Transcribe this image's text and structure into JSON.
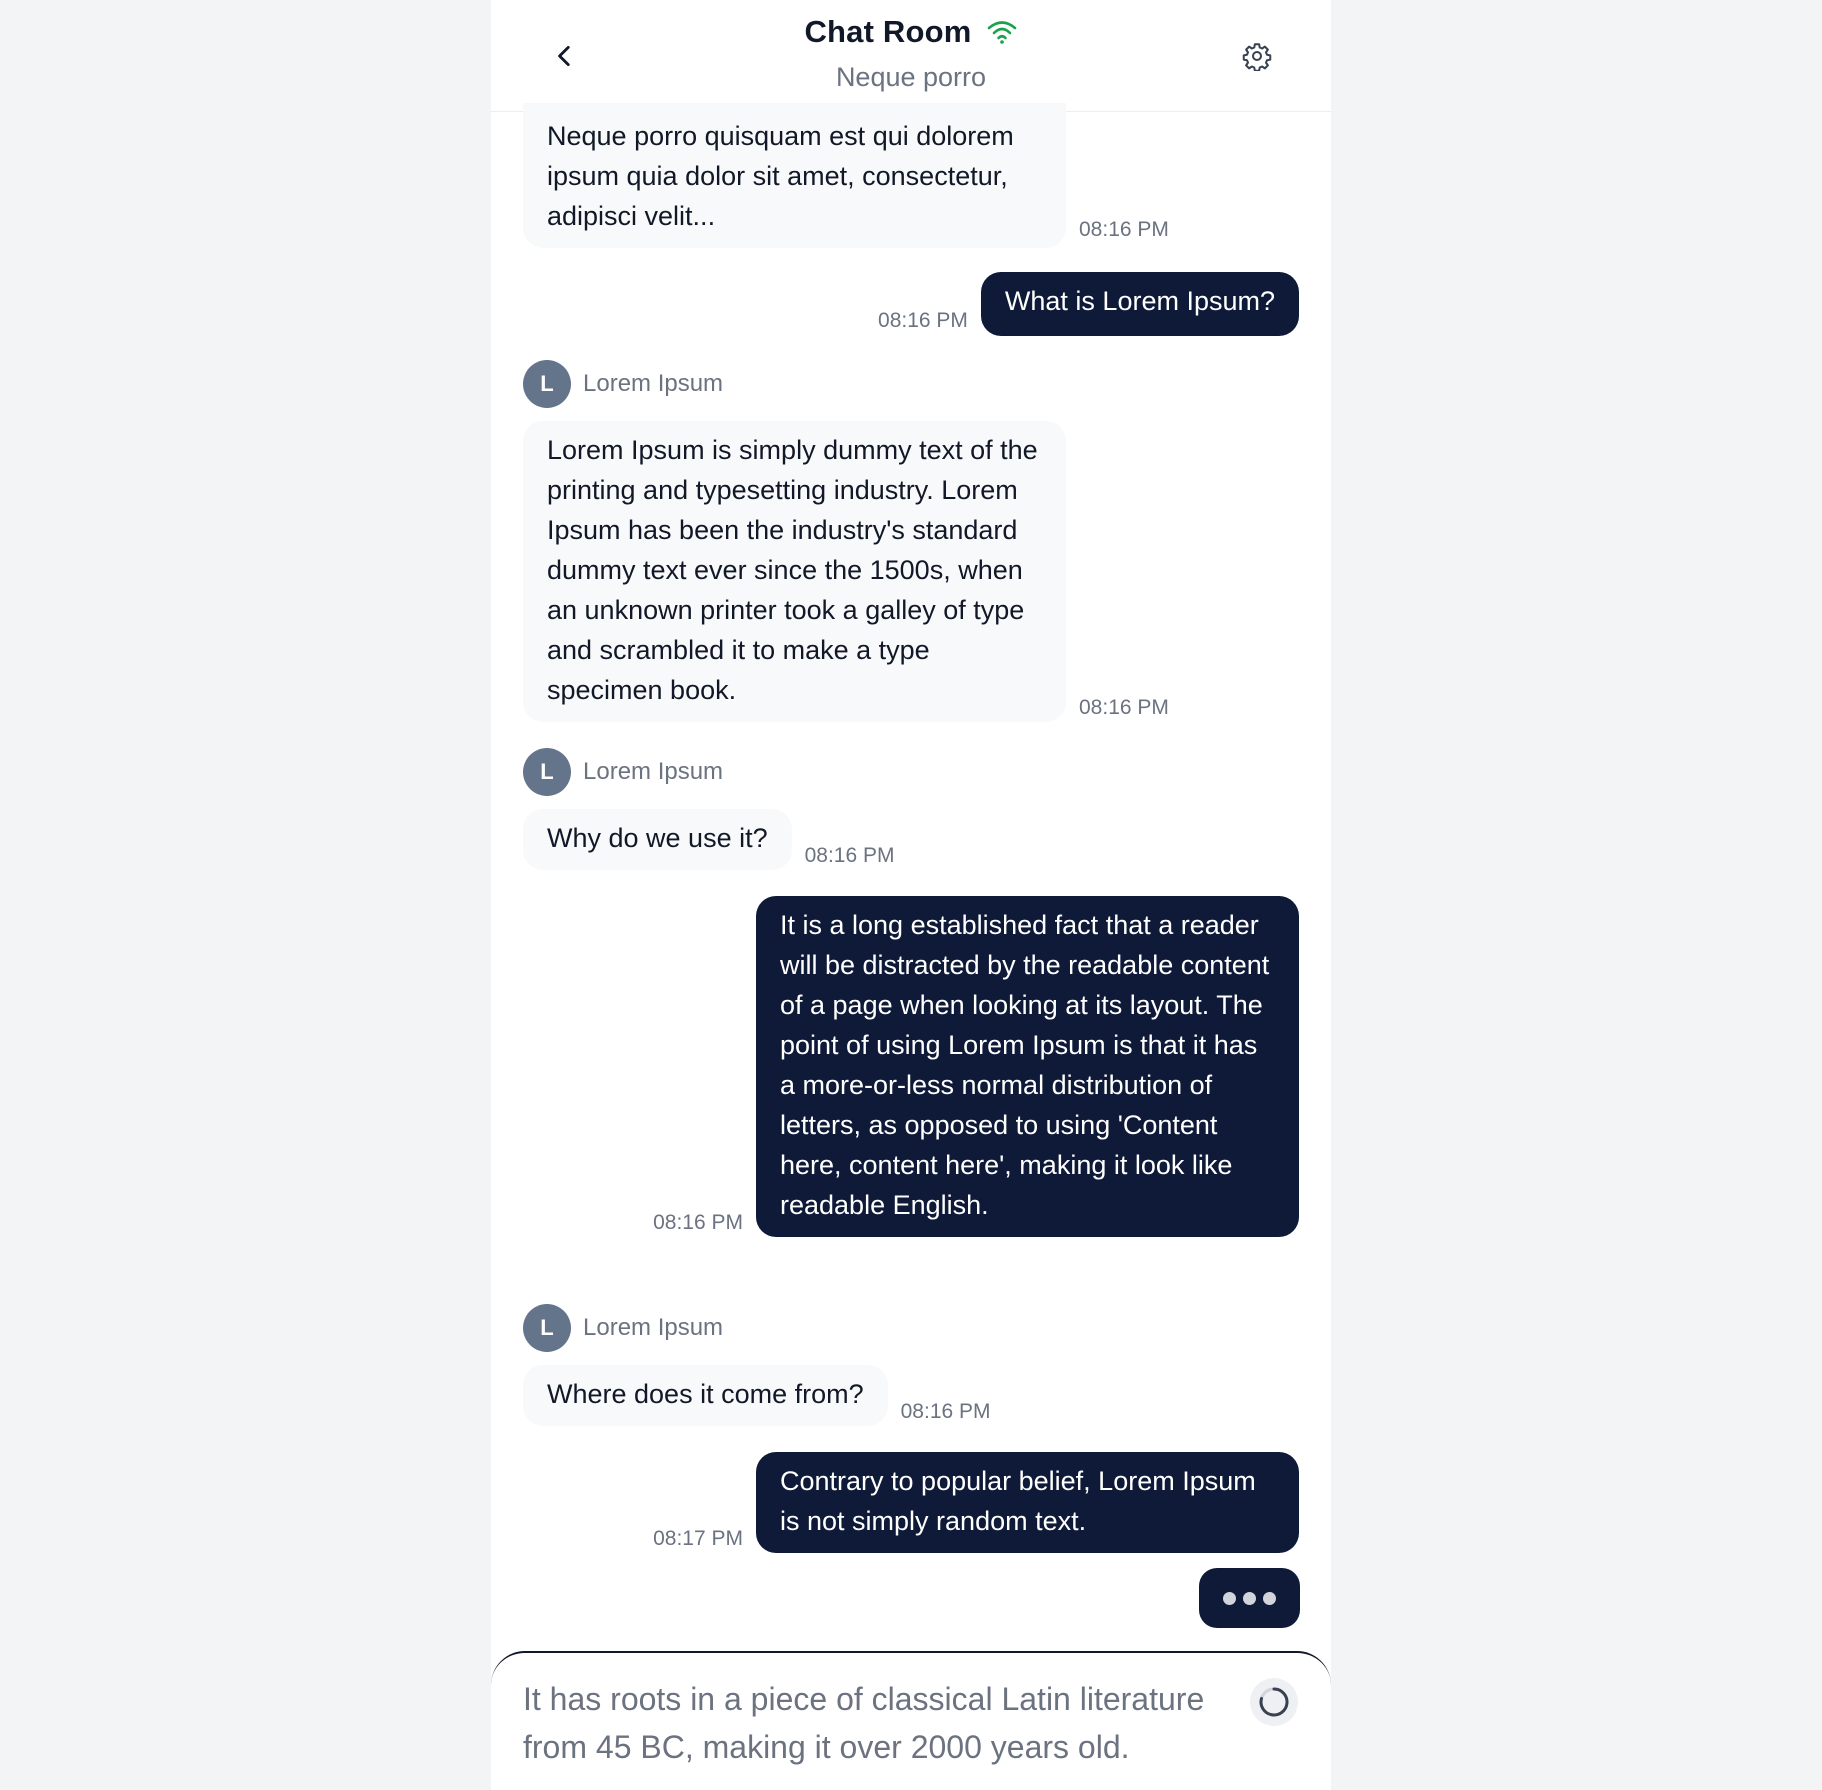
{
  "header": {
    "title": "Chat Room",
    "subtitle": "Neque porro",
    "connection_icon": "wifi-icon",
    "connection_color": "#16a34a"
  },
  "messages": [
    {
      "direction": "in",
      "text": "Neque porro quisquam est qui dolorem ipsum quia dolor sit amet, consectetur, adipisci velit...",
      "time": "08:16 PM"
    },
    {
      "direction": "out",
      "text": "What is Lorem Ipsum?",
      "time": "08:16 PM"
    },
    {
      "direction": "in",
      "sender": "Lorem Ipsum",
      "avatar": "L",
      "text": "Lorem Ipsum is simply dummy text of the printing and typesetting industry. Lorem Ipsum has been the industry's standard dummy text ever since the 1500s, when an unknown printer took a galley of type and scrambled it to make a type specimen book.",
      "time": "08:16 PM"
    },
    {
      "direction": "in",
      "sender": "Lorem Ipsum",
      "avatar": "L",
      "text": "Why do we use it?",
      "time": "08:16 PM"
    },
    {
      "direction": "out",
      "text": "It is a long established fact that a reader will be distracted by the readable content of a page when looking at its layout. The point of using Lorem Ipsum is that it has a more-or-less normal distribution of letters, as opposed to using 'Content here, content here', making it look like readable English.",
      "time": "08:16 PM"
    },
    {
      "direction": "in",
      "sender": "Lorem Ipsum",
      "avatar": "L",
      "text": "Where does it come from?",
      "time": "08:16 PM"
    },
    {
      "direction": "out",
      "text": "Contrary to popular belief, Lorem Ipsum is not simply random text.",
      "time": "08:17 PM"
    }
  ],
  "composer": {
    "value": "It has roots in a piece of classical Latin literature from 45 BC, making it over 2000 years old."
  },
  "colors": {
    "outgoing_bubble": "#0e1a38",
    "incoming_bubble": "#f8f9fa",
    "avatar": "#64748b"
  }
}
